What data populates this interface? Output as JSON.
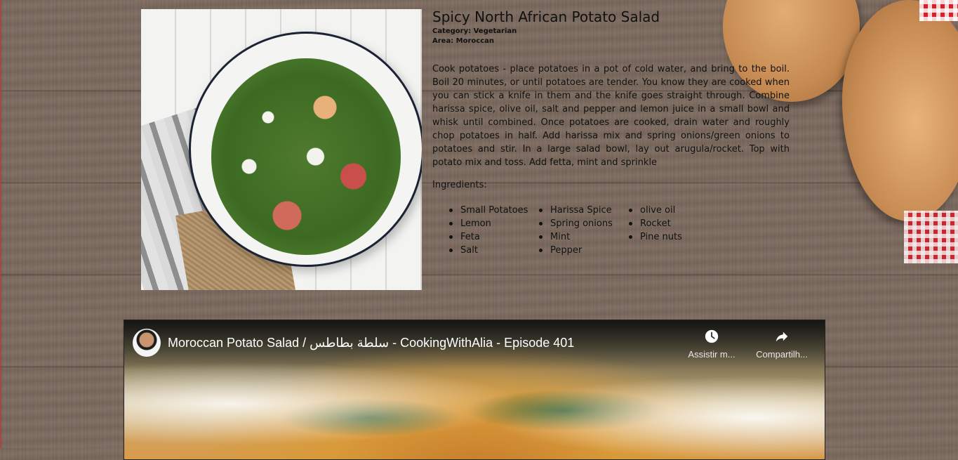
{
  "recipe": {
    "title": "Spicy North African Potato Salad",
    "category": "Category: Vegetarian",
    "area": "Area: Moroccan",
    "instructions": "Cook potatoes - place potatoes in a pot of cold water, and bring to the boil. Boil 20 minutes, or until potatoes are tender. You know they are cooked when you can stick a knife in them and the knife goes straight through. Combine harissa spice, olive oil, salt and pepper and lemon juice in a small bowl and whisk until combined. Once potatoes are cooked, drain water and roughly chop potatoes in half. Add harissa mix and spring onions/green onions to potatoes and stir. In a large salad bowl, lay out arugula/rocket. Top with potato mix and toss. Add fetta, mint and sprinkle",
    "ingredients_label": "Ingredients:",
    "ingredients": {
      "column1": [
        "Small Potatoes",
        "Lemon",
        "Feta",
        "Salt"
      ],
      "column2": [
        "Harissa Spice",
        "Spring onions",
        "Mint",
        "Pepper"
      ],
      "column3": [
        "olive oil",
        "Rocket",
        "Pine nuts"
      ]
    }
  },
  "video": {
    "title": "Moroccan Potato Salad / سلطة بطاطس - CookingWithAlia - Episode 401",
    "watch_later_label": "Assistir m...",
    "share_label": "Compartilh...",
    "icons": {
      "watch_later": "clock-icon",
      "share": "share-arrow-icon"
    }
  }
}
